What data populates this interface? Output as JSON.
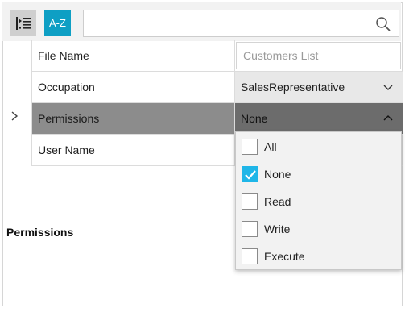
{
  "toolbar": {
    "categorize_icon": "categorize-icon",
    "sort_label": "A-Z",
    "search": {
      "value": "",
      "placeholder": ""
    },
    "search_icon": "search-icon"
  },
  "properties": [
    {
      "name": "File Name",
      "value": "Customers List"
    },
    {
      "name": "Occupation",
      "value": "SalesRepresentative"
    },
    {
      "name": "Permissions",
      "value": "None"
    },
    {
      "name": "User Name",
      "value": ""
    }
  ],
  "dropdown": {
    "options": [
      {
        "label": "All",
        "checked": false
      },
      {
        "label": "None",
        "checked": true
      },
      {
        "label": "Read",
        "checked": false
      },
      {
        "label": "Write",
        "checked": false
      },
      {
        "label": "Execute",
        "checked": false
      }
    ]
  },
  "description": {
    "title": "Permissions"
  },
  "colors": {
    "accent": "#0e9fc4",
    "check": "#1fb6e8",
    "selected_name_bg": "#8c8c8c",
    "selected_value_bg": "#6c6c6c"
  }
}
